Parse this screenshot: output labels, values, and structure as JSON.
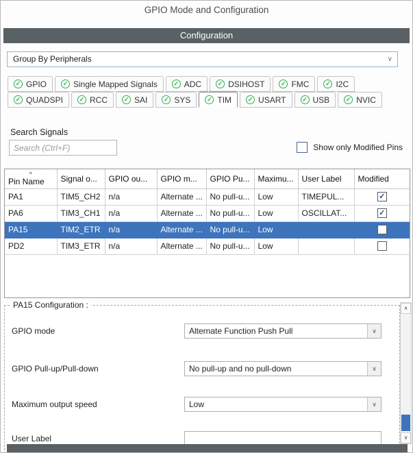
{
  "colors": {
    "accent_blue": "#3d74bc",
    "check_green": "#2fae4f",
    "header_gray": "#5a6164"
  },
  "icons": {
    "check": "✓",
    "chevron_down": "∨",
    "chevron_up": "∧",
    "sort_asc": "^"
  },
  "header": {
    "title": "GPIO Mode and Configuration",
    "section_title": "Configuration"
  },
  "group_by": {
    "value": "Group By Peripherals"
  },
  "tabs": {
    "rows": [
      [
        {
          "label": "GPIO"
        },
        {
          "label": "Single Mapped Signals"
        },
        {
          "label": "ADC"
        },
        {
          "label": "DSIHOST"
        },
        {
          "label": "FMC"
        },
        {
          "label": "I2C"
        }
      ],
      [
        {
          "label": "QUADSPI"
        },
        {
          "label": "RCC"
        },
        {
          "label": "SAI"
        },
        {
          "label": "SYS"
        },
        {
          "label": "TIM",
          "active": true
        },
        {
          "label": "USART"
        },
        {
          "label": "USB"
        },
        {
          "label": "NVIC"
        }
      ]
    ]
  },
  "search": {
    "label": "Search Signals",
    "placeholder": "Search (Ctrl+F)",
    "filter_label": "Show only Modified Pins",
    "filter_checked": false
  },
  "table": {
    "columns": [
      "Pin Name",
      "Signal o...",
      "GPIO ou...",
      "GPIO m...",
      "GPIO Pu...",
      "Maximu...",
      "User Label",
      "Modified"
    ],
    "rows": [
      {
        "cells": [
          "PA1",
          "TIM5_CH2",
          "n/a",
          "Alternate ...",
          "No pull-u...",
          "Low",
          "TIMEPUL..."
        ],
        "modified": true,
        "selected": false
      },
      {
        "cells": [
          "PA6",
          "TIM3_CH1",
          "n/a",
          "Alternate ...",
          "No pull-u...",
          "Low",
          "OSCILLAT..."
        ],
        "modified": true,
        "selected": false
      },
      {
        "cells": [
          "PA15",
          "TIM2_ETR",
          "n/a",
          "Alternate ...",
          "No pull-u...",
          "Low",
          ""
        ],
        "modified": false,
        "selected": true
      },
      {
        "cells": [
          "PD2",
          "TIM3_ETR",
          "n/a",
          "Alternate ...",
          "No pull-u...",
          "Low",
          ""
        ],
        "modified": false,
        "selected": false
      }
    ]
  },
  "config_panel": {
    "title": "PA15 Configuration :",
    "fields": [
      {
        "label": "GPIO mode",
        "value": "Alternate Function Push Pull",
        "type": "select"
      },
      {
        "label": "GPIO Pull-up/Pull-down",
        "value": "No pull-up and no pull-down",
        "type": "select"
      },
      {
        "label": "Maximum output speed",
        "value": "Low",
        "type": "select"
      },
      {
        "label": "User Label",
        "value": "",
        "type": "text"
      }
    ]
  }
}
